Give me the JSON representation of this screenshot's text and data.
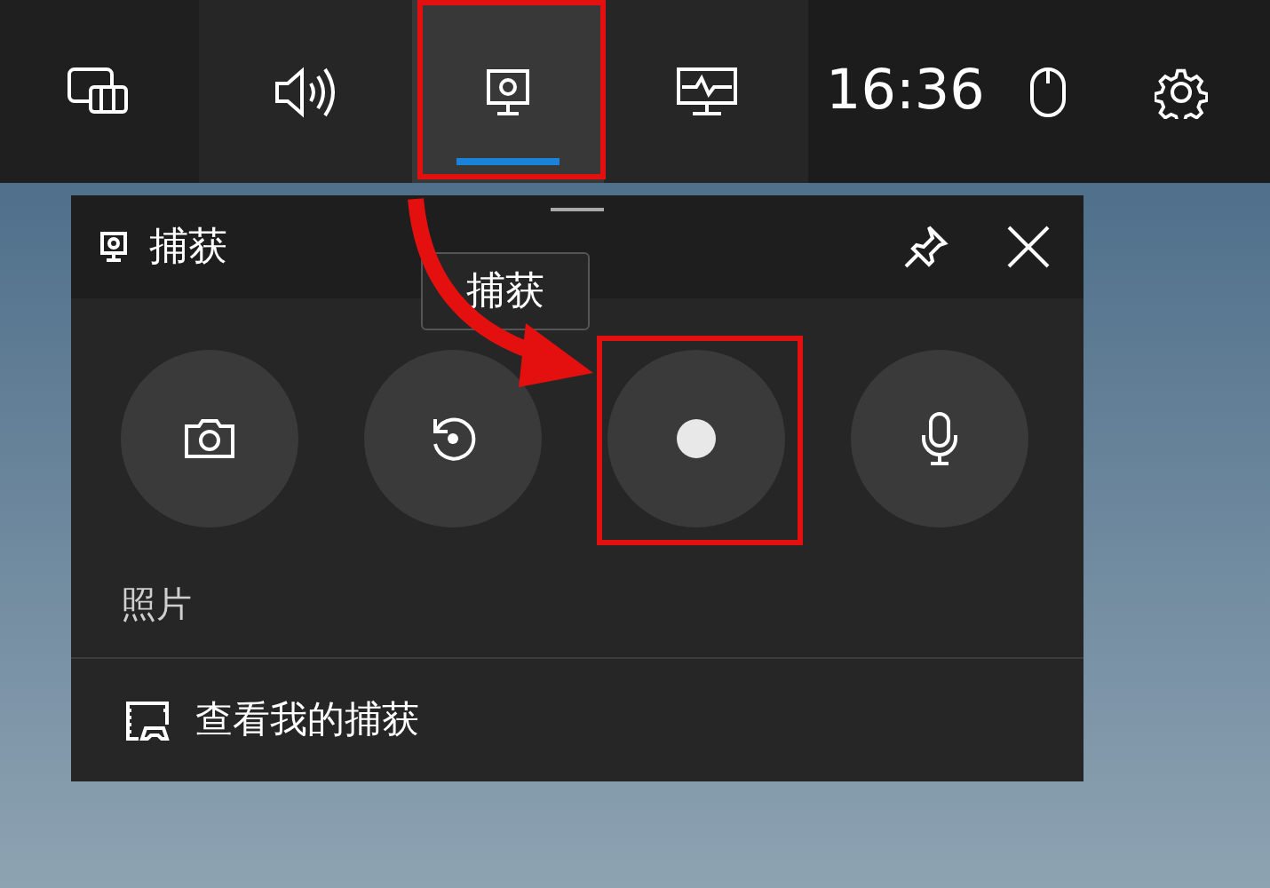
{
  "top_bar": {
    "items": [
      {
        "kind": "widgets",
        "selected": false,
        "highlighted": false
      },
      {
        "kind": "audio",
        "selected": false,
        "highlighted": false
      },
      {
        "kind": "capture",
        "selected": true,
        "highlighted": true
      },
      {
        "kind": "performance",
        "selected": false,
        "highlighted": false
      }
    ],
    "time": "16:36"
  },
  "panel": {
    "title": "捕获",
    "tooltip": "捕获",
    "buttons": [
      {
        "kind": "screenshot",
        "highlighted": false
      },
      {
        "kind": "record_last",
        "highlighted": false
      },
      {
        "kind": "record",
        "highlighted": true
      },
      {
        "kind": "microphone",
        "highlighted": false
      }
    ],
    "caption": "照片",
    "link": "查看我的捕获"
  }
}
